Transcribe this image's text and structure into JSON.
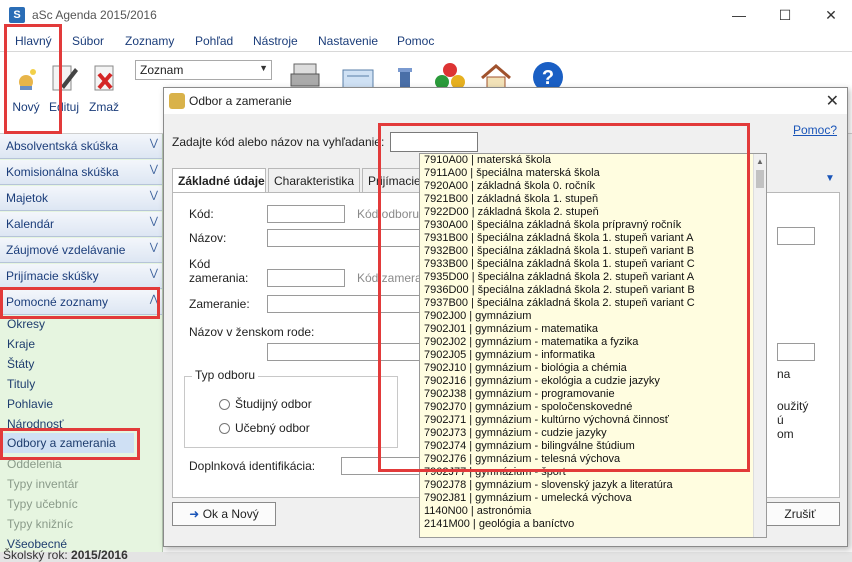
{
  "window": {
    "title": "aSc Agenda 2015/2016",
    "app_icon": "S"
  },
  "menu": [
    "Hlavný",
    "Súbor",
    "Zoznamy",
    "Pohľad",
    "Nástroje",
    "Nastavenie",
    "Pomoc"
  ],
  "ribbon": {
    "new_label": "Nový",
    "edit_label": "Edituj",
    "delete_label": "Zmaž",
    "combo_value": "Zoznam"
  },
  "sidebar": {
    "headers": [
      "Absolventská skúška",
      "Komisionálna skúška",
      "Majetok",
      "Kalendár",
      "Záujmové vzdelávanie",
      "Prijímacie skúšky",
      "Pomocné zoznamy"
    ],
    "items": [
      "Okresy",
      "Kraje",
      "Štáty",
      "Tituly",
      "Pohlavie",
      "Národnosť",
      "Odbory a zamerania",
      "Oddelenia",
      "Typy inventár",
      "Typy učebníc",
      "Typy knižníc",
      "Všeobecné"
    ]
  },
  "status": {
    "label": "Školský rok:",
    "value": "2015/2016"
  },
  "dialog": {
    "title": "Odbor a zameranie",
    "search_label": "Zadajte kód alebo názov na vyhľadanie:",
    "search_value": "",
    "help_link": "Pomoc?",
    "tabs": [
      "Základné údaje",
      "Charakteristika",
      "Prijímacie"
    ],
    "fields": {
      "kod": "Kód:",
      "kod_hint": "Kód odboru v",
      "nazov": "Názov:",
      "kod_zamerania_1": "Kód",
      "kod_zamerania_2": "zamerania:",
      "kod_zamerania_hint": "Kód zamerani",
      "zameranie": "Zameranie:",
      "nazov_zensky": "Názov v ženskom rode:",
      "doplnkova": "Doplnková identifikácia:"
    },
    "typ_odboru": {
      "label": "Typ odboru",
      "options": [
        "Študijný odbor",
        "Učebný odbor"
      ]
    },
    "ok_button": "Ok a Nový",
    "cancel_button": "Zrušiť",
    "right_fragments": [
      "na",
      "oužitý",
      "ú",
      "om"
    ]
  },
  "dropdown_items": [
    "7910A00 | materská škola",
    "7911A00 | špeciálna materská škola",
    "7920A00 | základná škola 0. ročník",
    "7921B00 | základná škola 1. stupeň",
    "7922D00 | základná škola 2. stupeň",
    "7930A00 | špeciálna základná škola prípravný ročník",
    "7931B00 | špeciálna základná škola 1. stupeň variant A",
    "7932B00 | špeciálna základná škola 1. stupeň variant B",
    "7933B00 | špeciálna základná škola 1. stupeň variant C",
    "7935D00 | špeciálna základná škola 2. stupeň variant A",
    "7936D00 | špeciálna základná škola 2. stupeň variant B",
    "7937B00 | špeciálna základná škola 2. stupeň variant C",
    "7902J00 | gymnázium",
    "7902J01 | gymnázium - matematika",
    "7902J02 | gymnázium - matematika a fyzika",
    "7902J05 | gymnázium - informatika",
    "7902J10 | gymnázium - biológia a chémia",
    "7902J16 | gymnázium - ekológia a cudzie jazyky",
    "7902J38 | gymnázium - programovanie",
    "7902J70 | gymnázium - spoločenskovedné",
    "7902J71 | gymnázium - kultúrno výchovná činnosť",
    "7902J73 | gymnázium - cudzie jazyky",
    "7902J74 | gymnázium - bilingválne štúdium",
    "7902J76 | gymnázium - telesná výchova",
    "7902J77 | gymnázium - šport",
    "7902J78 | gymnázium - slovenský jazyk a literatúra",
    "7902J81 | gymnázium - umelecká výchova",
    "1140N00 | astronómia",
    "2141M00 | geológia a baníctvo"
  ],
  "colors": {
    "annotation": "#e23a3a",
    "dropdown_bg": "#fffde0",
    "sidebar_bg": "#e6f5e0"
  }
}
